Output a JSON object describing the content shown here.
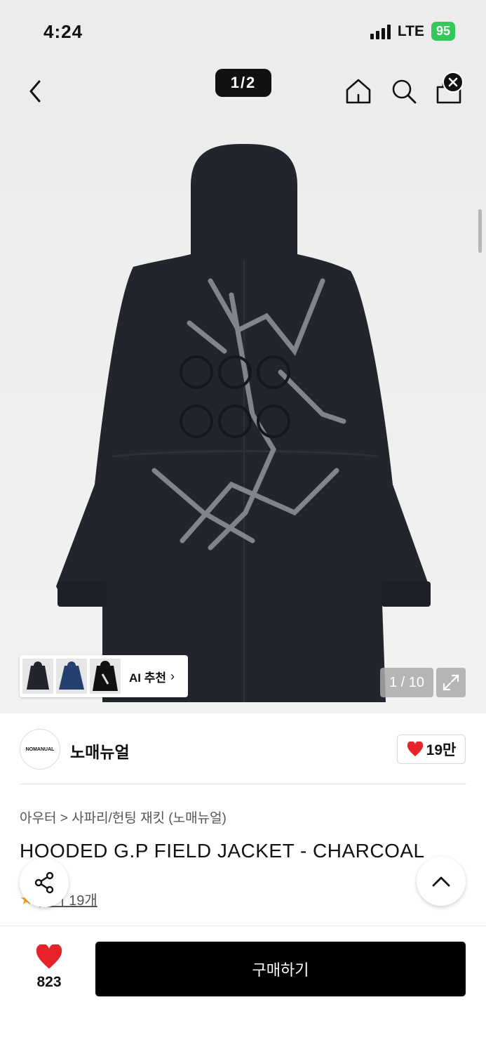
{
  "status_bar": {
    "time": "4:24",
    "network": "LTE",
    "battery": "95"
  },
  "nav": {
    "page_indicator": "1/2"
  },
  "gallery": {
    "ai_recommend_label": "AI 추천",
    "image_counter": "1 / 10"
  },
  "brand": {
    "logo_text": "NOMANUAL",
    "name": "노매뉴얼",
    "likes": "19만"
  },
  "product": {
    "breadcrumb": [
      "아우터",
      "사파리/헌팅 재킷 (노매뉴얼)"
    ],
    "title": "HOODED G.P FIELD JACKET - CHARCOAL",
    "reviews": "후기 19개"
  },
  "bottom_bar": {
    "wish_count": "823",
    "buy_label": "구매하기"
  },
  "colors": {
    "accent": "#e8222b",
    "battery": "#34c759",
    "jacket": "#22252c"
  },
  "icons": [
    "back-icon",
    "home-icon",
    "search-icon",
    "cart-icon",
    "close-icon",
    "expand-icon",
    "share-icon",
    "chevron-up-icon",
    "heart-icon",
    "star-icon"
  ]
}
